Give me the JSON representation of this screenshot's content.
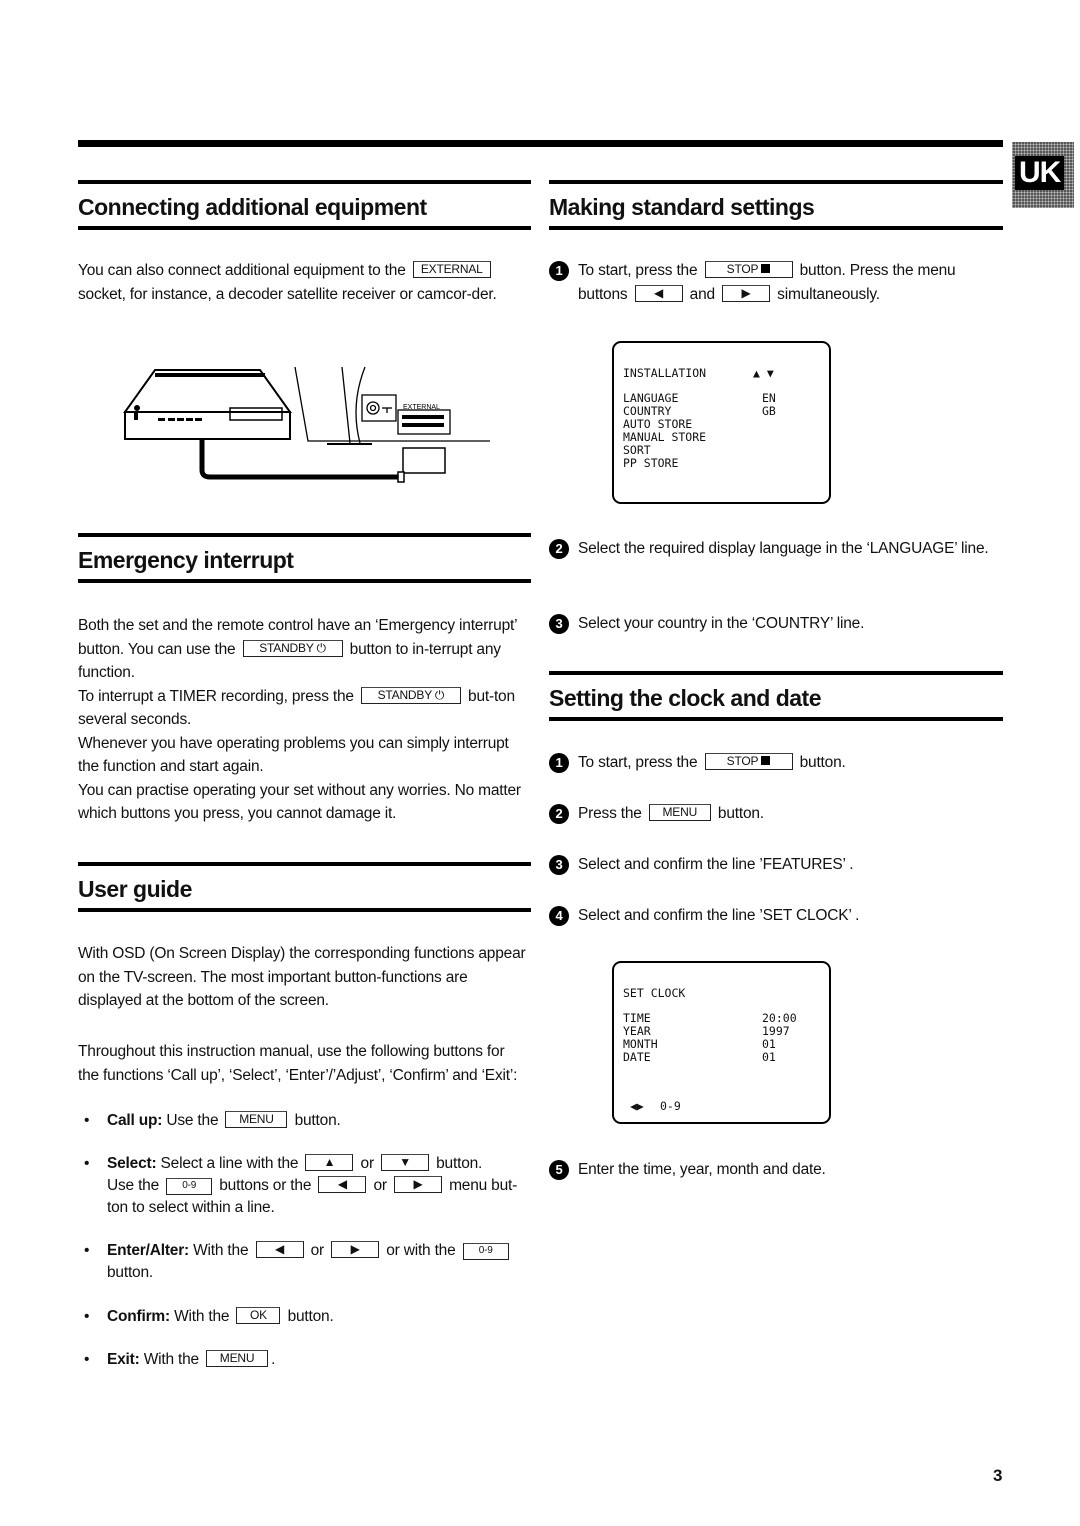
{
  "side_tab": {
    "label": "UK"
  },
  "page_number": "3",
  "connecting": {
    "title": "Connecting additional equipment",
    "text_before": "You can also connect additional equipment to the",
    "button": "EXTERNAL",
    "text_after": "socket, for instance, a decoder satellite receiver or camcor-der.",
    "illustration": {
      "socket_label": "EXTERNAL"
    }
  },
  "emergency": {
    "title": "Emergency interrupt",
    "p1_a": "Both the set and the remote control have an ‘Emergency interrupt’ button. You can use the",
    "p1_btn": "STANDBY",
    "p1_b": "button to in-terrupt any function.",
    "p2_a": "To interrupt a TIMER recording, press the",
    "p2_btn": "STANDBY",
    "p2_b": "but-ton several seconds.",
    "p3": "Whenever you have operating problems you can simply interrupt the function and start again.",
    "p4": "You can practise operating your set without any worries. No matter which buttons you press, you cannot damage it."
  },
  "user_guide": {
    "title": "User guide",
    "p1": "With OSD (On Screen Display) the corresponding functions appear on the TV-screen. The most important button-functions are displayed at the bottom of the screen.",
    "p2": "Throughout this instruction manual, use the following buttons for the functions ‘Call up’, ‘Select’, ‘Enter’/’Adjust’, ‘Confirm’ and ‘Exit’:",
    "bullets": {
      "callup": {
        "label": "Call up:",
        "a": "Use the",
        "btn": "MENU",
        "b": "button."
      },
      "select": {
        "label": "Select:",
        "a": "Select a line with the",
        "or1": "or",
        "b": "button.",
        "c": "Use the",
        "btn09": "0-9",
        "d": "buttons or the",
        "or2": "or",
        "e": "menu but-ton to select within a line."
      },
      "enter": {
        "label": "Enter/Alter:",
        "a": "With the",
        "or1": "or",
        "b": "or with the",
        "btn09": "0-9",
        "c": "button."
      },
      "confirm": {
        "label": "Confirm:",
        "a": "With the",
        "btn": "OK",
        "b": "button."
      },
      "exit": {
        "label": "Exit:",
        "a": "With the",
        "btn": "MENU",
        "b": "."
      }
    }
  },
  "standard_settings": {
    "title": "Making standard settings",
    "steps": [
      {
        "n": "1",
        "a": "To start, press the",
        "btn": "STOP",
        "b": "button. Press the menu",
        "c": "buttons",
        "and": "and",
        "d": "simultaneously."
      },
      {
        "n": "2",
        "text": "Select the required display language in the ‘LANGUAGE’ line."
      },
      {
        "n": "3",
        "text": "Select your country in the ‘COUNTRY’ line."
      }
    ],
    "osd": {
      "title": "INSTALLATION",
      "rows": [
        {
          "label": "LANGUAGE",
          "value": "EN"
        },
        {
          "label": "COUNTRY",
          "value": "GB"
        },
        {
          "label": "AUTO STORE",
          "value": ""
        },
        {
          "label": "MANUAL STORE",
          "value": ""
        },
        {
          "label": "SORT",
          "value": ""
        },
        {
          "label": "PP STORE",
          "value": ""
        }
      ]
    }
  },
  "clock": {
    "title": "Setting the clock and date",
    "steps": [
      {
        "n": "1",
        "a": "To start, press the",
        "btn": "STOP",
        "b": "button."
      },
      {
        "n": "2",
        "a": "Press the",
        "btn": "MENU",
        "b": "button."
      },
      {
        "n": "3",
        "text": "Select and confirm the line ’FEATURES’ ."
      },
      {
        "n": "4",
        "text": "Select and confirm the line ’SET CLOCK’ ."
      },
      {
        "n": "5",
        "text": "Enter the time, year, month and date."
      }
    ],
    "osd": {
      "title": "SET CLOCK",
      "rows": [
        {
          "label": "TIME",
          "value": "20:00"
        },
        {
          "label": "YEAR",
          "value": "1997"
        },
        {
          "label": "MONTH",
          "value": "01"
        },
        {
          "label": "DATE",
          "value": "01"
        }
      ],
      "footer": "0-9"
    }
  }
}
